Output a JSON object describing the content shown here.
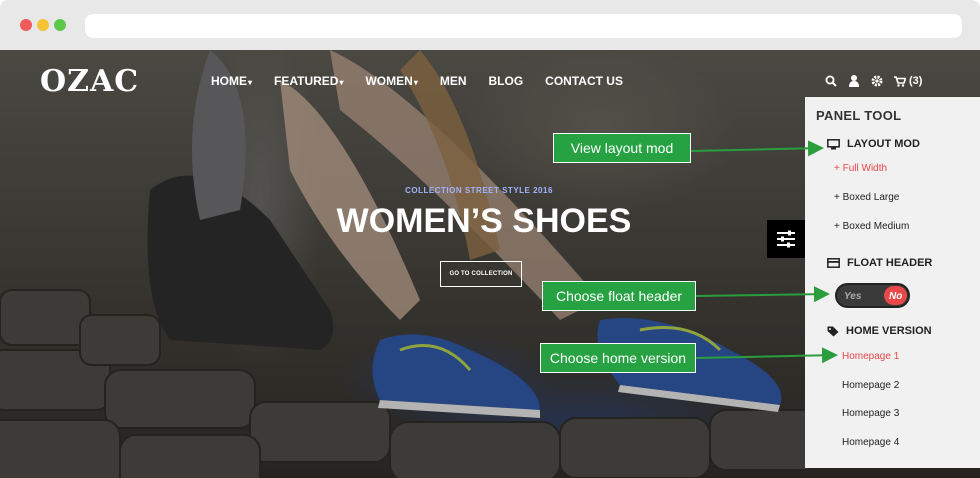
{
  "brand": {
    "logo": "OZAC"
  },
  "nav": {
    "items": [
      {
        "label": "HOME",
        "caret": "▾"
      },
      {
        "label": "FEATURED",
        "caret": "▾"
      },
      {
        "label": "WOMEN",
        "caret": "▾"
      },
      {
        "label": "MEN",
        "caret": ""
      },
      {
        "label": "BLOG",
        "caret": ""
      },
      {
        "label": "CONTACT US",
        "caret": ""
      }
    ],
    "cart_count": "(3)",
    "icons": [
      "search-icon",
      "user-icon",
      "gear-icon",
      "cart-icon"
    ]
  },
  "hero": {
    "kicker": "COLLECTION STREET STYLE 2016",
    "headline": "WOMEN’S SHOES",
    "cta": "GO TO COLLECTION"
  },
  "panel": {
    "title": "PANEL TOOL",
    "layout_title": "LAYOUT MOD",
    "layout_options": [
      "+ Full Width",
      "+ Boxed Large",
      "+ Boxed Medium"
    ],
    "float_title": "FLOAT HEADER",
    "toggle": {
      "yes": "Yes",
      "no": "No"
    },
    "home_title": "HOME VERSION",
    "home_options": [
      "Homepage 1",
      "Homepage 2",
      "Homepage 3",
      "Homepage 4"
    ]
  },
  "callouts": {
    "layout": "View layout mod",
    "float": "Choose float header",
    "home": "Choose home version"
  },
  "colors": {
    "accent": "#e8474b",
    "callout": "#27a243",
    "arrow": "#2a9d3c"
  }
}
